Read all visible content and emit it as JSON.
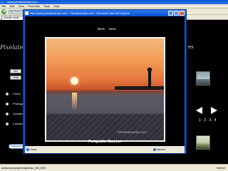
{
  "background_window": {
    "title": "www.pixelatestudio.com",
    "menu": [
      "File",
      "Edit",
      "View",
      "Favorites",
      "Tools",
      "Help"
    ],
    "address": "http://www.pixelatestudio.com/",
    "tab_label": "pixelate studio",
    "site": {
      "logo_text": "Pixelate studio",
      "logo_right": "es",
      "buttons": [
        "Info",
        "Links"
      ],
      "nav": [
        "Home",
        "Photogallery",
        "Guestbook",
        "Contact"
      ],
      "pill": "Wallpapers",
      "pager": "1 · 2 · 3 · 4"
    },
    "status_left": "javascript:popup('images/dsc_450_550')",
    "status_right": "Internet"
  },
  "popup": {
    "title": "http://www.pixelatestudio.com - Pixelatestudio.com - Microsoft Internet Explorer",
    "nav_back": "Back",
    "nav_next": "Next",
    "watermark": "©Pixelatestudio.com",
    "caption": "Perkpolder Sunrise",
    "status_done": "Done",
    "status_zone": "Internet"
  }
}
